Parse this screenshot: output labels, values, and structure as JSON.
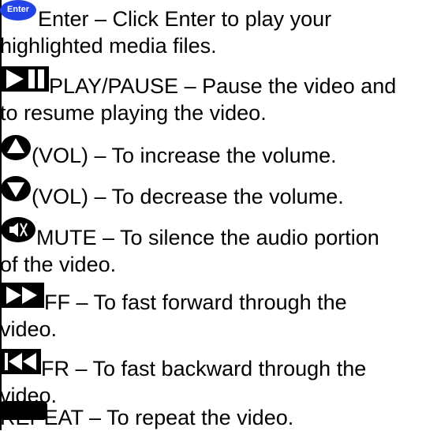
{
  "icons": {
    "enter_badge_text": "Enter",
    "enter_color": "#2244e6",
    "icon_color": "#000000",
    "names": [
      "enter-icon",
      "play-pause-icon",
      "volume-up-icon",
      "volume-down-icon",
      "mute-icon",
      "fast-forward-icon",
      "fast-rewind-icon",
      "repeat-icon"
    ]
  },
  "items": [
    {
      "line1": "Enter – Click Enter to play your",
      "line2": "highlighted media files."
    },
    {
      "line1": "PLAY/PAUSE – Pause the video and",
      "line2": "to resume playing the video."
    },
    {
      "line1": "(VOL) – To increase the volume."
    },
    {
      "line1": "(VOL) – To decrease the volume."
    },
    {
      "line1": "MUTE – To silence the audio portion",
      "line2": "of the video."
    },
    {
      "line1": "FF – To fast forward through the",
      "line2": "video."
    },
    {
      "line1": "FR – To fast backward through the",
      "line2": "video."
    },
    {
      "line1": "REPEAT – To repeat the video."
    }
  ]
}
